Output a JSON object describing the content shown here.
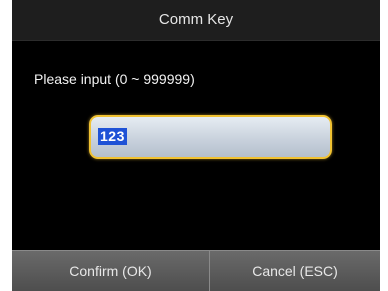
{
  "dialog": {
    "title": "Comm Key",
    "prompt": "Please input (0 ~ 999999)",
    "input_value": "123"
  },
  "softkeys": {
    "confirm_label": "Confirm (OK)",
    "cancel_label": "Cancel (ESC)"
  },
  "colors": {
    "background": "#000000",
    "input_border": "#f1c232",
    "selection": "#1f52d6"
  }
}
